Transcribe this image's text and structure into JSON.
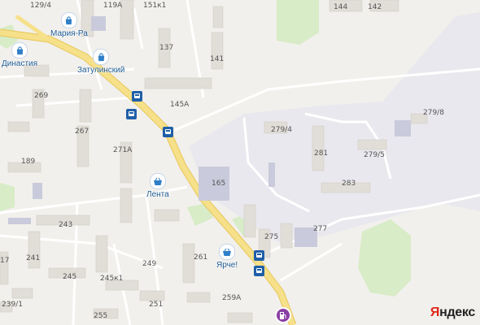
{
  "map": {
    "house_numbers": [
      {
        "id": "h129-4",
        "text": "129/4"
      },
      {
        "id": "h119a",
        "text": "119А"
      },
      {
        "id": "h151k1",
        "text": "151к1"
      },
      {
        "id": "h144",
        "text": "144"
      },
      {
        "id": "h142",
        "text": "142"
      },
      {
        "id": "h137",
        "text": "137"
      },
      {
        "id": "h141",
        "text": "141"
      },
      {
        "id": "h269",
        "text": "269"
      },
      {
        "id": "h145a",
        "text": "145А"
      },
      {
        "id": "h279-4",
        "text": "279/4"
      },
      {
        "id": "h279-8",
        "text": "279/8"
      },
      {
        "id": "h267",
        "text": "267"
      },
      {
        "id": "h271a",
        "text": "271А"
      },
      {
        "id": "h281",
        "text": "281"
      },
      {
        "id": "h279-5",
        "text": "279/5"
      },
      {
        "id": "h189",
        "text": "189"
      },
      {
        "id": "h165",
        "text": "165"
      },
      {
        "id": "h283",
        "text": "283"
      },
      {
        "id": "h243",
        "text": "243"
      },
      {
        "id": "h275",
        "text": "275"
      },
      {
        "id": "h277",
        "text": "277"
      },
      {
        "id": "h241",
        "text": "241"
      },
      {
        "id": "h249",
        "text": "249"
      },
      {
        "id": "h261",
        "text": "261"
      },
      {
        "id": "h245",
        "text": "245"
      },
      {
        "id": "h245k1",
        "text": "245к1"
      },
      {
        "id": "h239-1",
        "text": "239/1"
      },
      {
        "id": "h251",
        "text": "251"
      },
      {
        "id": "h259a",
        "text": "259А"
      },
      {
        "id": "h255",
        "text": "255"
      },
      {
        "id": "h17",
        "text": "17"
      }
    ],
    "pois": {
      "maria_ra": "Мария-Ра",
      "dinastia": "Династия",
      "zatulinsky": "Затулинский",
      "lenta": "Лента",
      "yarche": "Ярче!"
    },
    "brand": {
      "first_letter": "Я",
      "rest": "ндекс"
    },
    "colors": {
      "background": "#f2f0ec",
      "main_road": "#f6e08a",
      "building": "#e1ddd7",
      "industrial": "#e9e8ee",
      "industrial_building": "#c9cadb",
      "green": "#d7ecc7",
      "poi_text": "#1f5d96",
      "stop": "#1f5fa8",
      "fuel": "#8a3fa3"
    },
    "icons": [
      "shopping-bag-icon",
      "shopping-basket-icon",
      "bus-stop-icon",
      "fuel-station-icon"
    ]
  }
}
